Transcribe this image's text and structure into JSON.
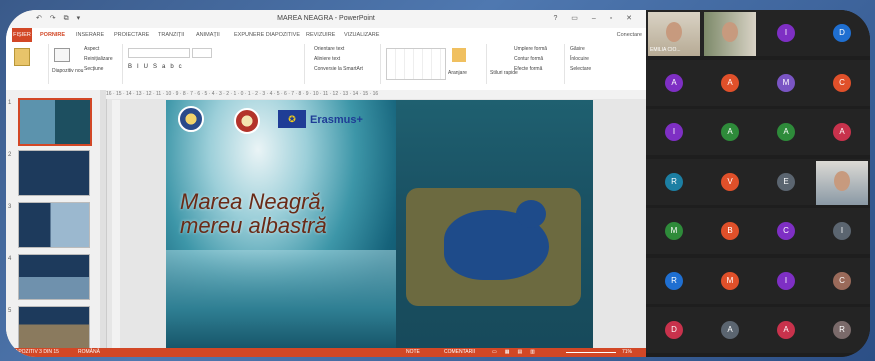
{
  "window": {
    "title": "MAREA NEAGRA - PowerPoint",
    "quick_access": "↶ ↷ ⧉ ▾",
    "controls": "? ▭ – ▫ ✕"
  },
  "tabs": [
    "FIȘIER",
    "PORNIRE",
    "INSERARE",
    "PROIECTARE",
    "TRANZIȚII",
    "ANIMAȚII",
    "EXPUNERE DIAPOZITIVE",
    "REVIZUIRE",
    "VIZUALIZARE"
  ],
  "signin": "Conectare",
  "ribbon": {
    "items": [
      "Aspect",
      "Reinițializare",
      "Secțiune",
      "Diapozitiv nou",
      "Orientare text",
      "Aliniere text",
      "Conversie la SmartArt",
      "Aranjare",
      "Stiluri rapide",
      "Umplere formă",
      "Contur formă",
      "Efecte formă",
      "Găsire",
      "Înlocuire",
      "Selectare"
    ]
  },
  "ruler": "16 · 15 · 14 · 13 · 12 · 11 · 10 · 9 · 8 · 7 · 6 · 5 · 4 · 3 · 2 · 1 · 0 · 1 · 2 · 3 · 4 · 5 · 6 · 7 · 8 · 9 · 10 · 11 · 12 · 13 · 14 · 15 · 16",
  "thumbnails": [
    {
      "num": "1"
    },
    {
      "num": "2"
    },
    {
      "num": "3"
    },
    {
      "num": "4"
    },
    {
      "num": "5"
    }
  ],
  "slide": {
    "title_line1": "Marea Neagră,",
    "title_line2": "mereu albastră",
    "erasmus": "Erasmus+"
  },
  "status": {
    "left": "DIAPOZITIV 3 DIN 15",
    "lang": "ROMÂNĂ",
    "notes": "NOTE",
    "comments": "COMENTARII",
    "zoom": "71%"
  },
  "participants": [
    {
      "type": "video",
      "name": "EMILIA CIO..."
    },
    {
      "type": "video",
      "name": ""
    },
    {
      "initial": "I",
      "color": "#7e2fc4"
    },
    {
      "initial": "D",
      "color": "#1f6fd1"
    },
    {
      "initial": "A",
      "color": "#7e2fc4"
    },
    {
      "initial": "A",
      "color": "#e0502a"
    },
    {
      "initial": "M",
      "color": "#7a55c4"
    },
    {
      "initial": "C",
      "color": "#e0502a"
    },
    {
      "initial": "I",
      "color": "#7e2fc4"
    },
    {
      "initial": "A",
      "color": "#2e8b3a"
    },
    {
      "initial": "A",
      "color": "#2e8b3a"
    },
    {
      "initial": "A",
      "color": "#c8324c"
    },
    {
      "initial": "R",
      "color": "#1c7fa3"
    },
    {
      "initial": "V",
      "color": "#e0502a"
    },
    {
      "initial": "E",
      "color": "#5b6570"
    },
    {
      "type": "video",
      "name": ""
    },
    {
      "initial": "M",
      "color": "#2e8b3a"
    },
    {
      "initial": "B",
      "color": "#e0502a"
    },
    {
      "initial": "C",
      "color": "#7e2fc4"
    },
    {
      "initial": "I",
      "color": "#5b6570"
    },
    {
      "initial": "R",
      "color": "#1f6fd1"
    },
    {
      "initial": "M",
      "color": "#e0502a"
    },
    {
      "initial": "I",
      "color": "#7e2fc4"
    },
    {
      "initial": "C",
      "color": "#9a6a5a"
    },
    {
      "initial": "D",
      "color": "#c8324c"
    },
    {
      "initial": "A",
      "color": "#5b6570"
    },
    {
      "initial": "A",
      "color": "#c8324c"
    },
    {
      "initial": "R",
      "color": "#7a6a6a"
    }
  ]
}
